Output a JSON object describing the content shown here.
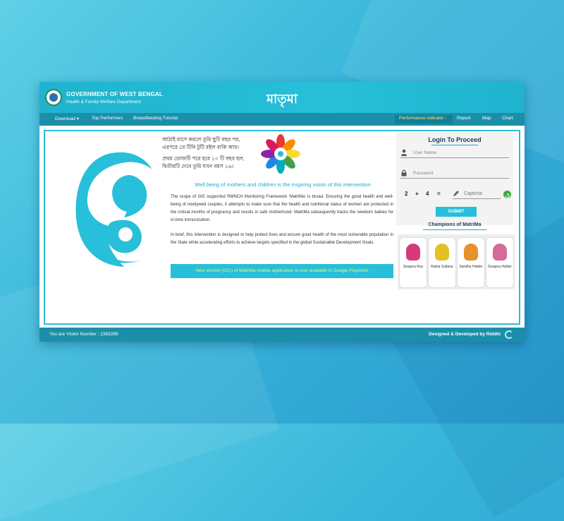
{
  "header": {
    "gov_title": "GOVERNMENT OF WEST BENGAL",
    "gov_subtitle": "Health & Family Welfare Department",
    "app_name": "মাতৃমা"
  },
  "nav": {
    "download": "Download ▾",
    "top_performers": "Top Performers",
    "breastfeeding": "Breastfeeding Tutorial",
    "performance_indicator": "Performance indicator :",
    "report": "Report",
    "map": "Map",
    "chart": "Chart"
  },
  "intro": {
    "line1": "আঠাই মাসে করলে তুমি ছুটি বছর পর,",
    "line2": "এরপরে তে টিবি টুটি রইল বাকি আর।",
    "line3": "প্রথম ডোজটি পরে হবে ১০ টি বছর হল,",
    "line4": "দ্বিতীয়টি দেবে তুমি যখন বয়স ১৬।"
  },
  "main": {
    "tagline": "Well being of mothers and children is the inspiring vision of this intervention",
    "para1": "The scope of GIS supported RMNCH Monitoring Framework 'MatriMa' is broad. Ensuring the good health and well-being of newlywed couples, it attempts to make sure that the health and nutritional status of women are protected in the critical months of pregnancy and results in safe motherhood. MatriMa subsequently tracks the newborn babies for in-time immunization.",
    "para2": "In brief, this intervention is designed to help protect lives and ensure good health of the most vulnerable population in the State while accelerating efforts to achieve targets specified in the global Sustainable Development Goals.",
    "banner": "New version (021) of MatriMa mobile application is now available in Google Playstore"
  },
  "login": {
    "title": "Login To Proceed",
    "username_placeholder": "User Name",
    "password_placeholder": "Password",
    "captcha_a": "2",
    "captcha_op": "+",
    "captcha_b": "4",
    "captcha_eq": "=",
    "captcha_placeholder": "Captcha",
    "submit": "SUBMIT"
  },
  "champions": {
    "title": "Champions of MatriMa",
    "people": [
      {
        "name": "Swapna Roy",
        "color": "#d43a7c"
      },
      {
        "name": "Rabia Sultana",
        "color": "#e2c126"
      },
      {
        "name": "Sandha Halder",
        "color": "#e8902e"
      },
      {
        "name": "Swapna Halder",
        "color": "#d66a9a"
      }
    ]
  },
  "footer": {
    "visitor": "You are Visitor Number : 2383289",
    "credit": "Designed & Developed by Riddhi"
  },
  "colors": {
    "accent": "#27bfd9",
    "nav": "#1b8fa9",
    "highlight": "#f3f56a"
  }
}
